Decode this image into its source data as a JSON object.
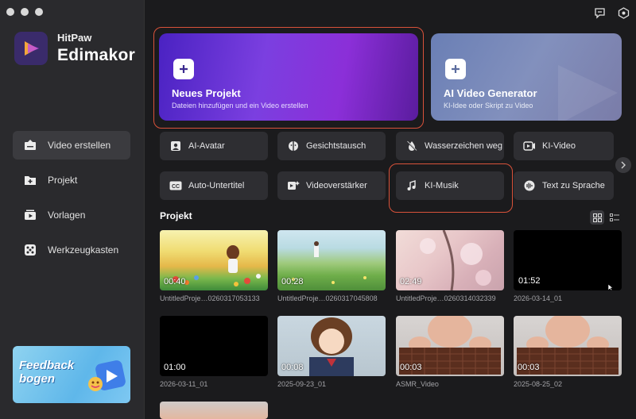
{
  "app": {
    "brand_line1": "HitPaw",
    "brand_line2": "Edimakor"
  },
  "sidebar": {
    "items": [
      {
        "label": "Video erstellen",
        "icon": "video-create-icon",
        "active": true
      },
      {
        "label": "Projekt",
        "icon": "folder-plus-icon",
        "active": false
      },
      {
        "label": "Vorlagen",
        "icon": "template-icon",
        "active": false
      },
      {
        "label": "Werkzeugkasten",
        "icon": "toolbox-icon",
        "active": false
      }
    ],
    "feedback_line1": "Feedback",
    "feedback_line2": "bogen"
  },
  "hero": {
    "new_project_title": "Neues Projekt",
    "new_project_sub": "Dateien hinzufügen und ein Video erstellen",
    "ai_generator_title": "AI Video Generator",
    "ai_generator_sub": "KI-Idee oder Skript zu Video"
  },
  "tools": [
    {
      "label": "AI-Avatar",
      "icon": "avatar-icon"
    },
    {
      "label": "Gesichtstausch",
      "icon": "face-swap-icon"
    },
    {
      "label": "Wasserzeichen weg",
      "icon": "watermark-remove-icon"
    },
    {
      "label": "KI-Video",
      "icon": "ai-video-icon"
    },
    {
      "label": "Auto-Untertitel",
      "icon": "subtitle-icon"
    },
    {
      "label": "Videoverstärker",
      "icon": "video-enhance-icon"
    },
    {
      "label": "KI-Musik",
      "icon": "music-icon"
    },
    {
      "label": "Text zu Sprache",
      "icon": "text-to-speech-icon"
    }
  ],
  "projects_section": {
    "title": "Projekt"
  },
  "projects": [
    {
      "duration": "00:40",
      "name": "UntitledProje…0260317053133"
    },
    {
      "duration": "00:28",
      "name": "UntitledProje…0260317045808"
    },
    {
      "duration": "02:49",
      "name": "UntitledProje…0260314032339"
    },
    {
      "duration": "01:52",
      "name": "2026-03-14_01"
    },
    {
      "duration": "01:00",
      "name": "2026-03-11_01"
    },
    {
      "duration": "00:08",
      "name": "2025-09-23_01"
    },
    {
      "duration": "00:03",
      "name": "ASMR_Video"
    },
    {
      "duration": "00:03",
      "name": "2025-08-25_02"
    }
  ],
  "colors": {
    "accent_purple": "#7b3fe0",
    "highlight_red": "#d9523a",
    "sidebar_bg": "#2a2a2d",
    "main_bg": "#1b1b1d"
  }
}
